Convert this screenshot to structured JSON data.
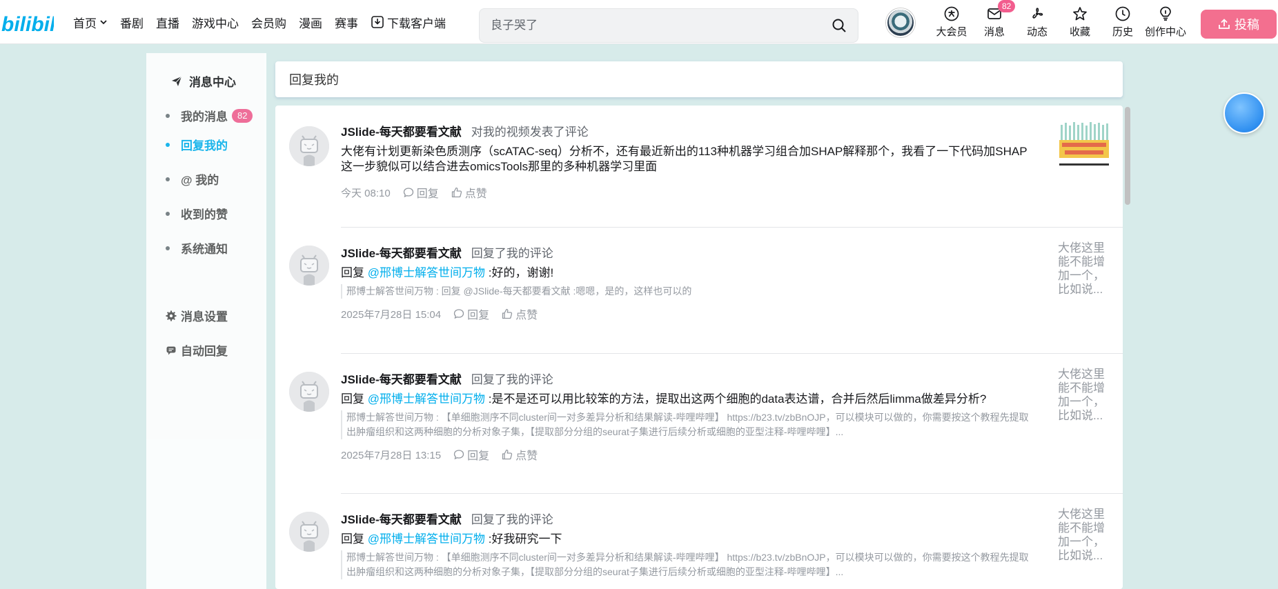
{
  "nav": {
    "items": [
      "首页",
      "番剧",
      "直播",
      "游戏中心",
      "会员购",
      "漫画",
      "赛事",
      "下载客户端"
    ],
    "search_placeholder": "良子哭了",
    "right": [
      {
        "label": "大会员",
        "icon": "vip-icon"
      },
      {
        "label": "消息",
        "icon": "message-icon",
        "badge": "82"
      },
      {
        "label": "动态",
        "icon": "dynamic-icon"
      },
      {
        "label": "收藏",
        "icon": "star-icon"
      },
      {
        "label": "历史",
        "icon": "history-icon"
      },
      {
        "label": "创作中心",
        "icon": "bulb-icon"
      }
    ],
    "upload_label": "投稿"
  },
  "sidebar": {
    "title": "消息中心",
    "items": [
      {
        "label": "我的消息",
        "badge": "82"
      },
      {
        "label": "回复我的"
      },
      {
        "label": "@ 我的"
      },
      {
        "label": "收到的赞"
      },
      {
        "label": "系统通知"
      }
    ],
    "settings": "消息设置",
    "auto_reply": "自动回复"
  },
  "header": {
    "title": "回复我的"
  },
  "replies": [
    {
      "user": "JSlide-每天都要看文献",
      "action": "对我的视频发表了评论",
      "content": "大佬有计划更新染色质测序（scATAC-seq）分析不，还有最近新出的113种机器学习组合加SHAP解释那个，我看了一下代码加SHAP这一步貌似可以结合进去omicsTools那里的多种机器学习里面",
      "time": "今天 08:10",
      "reply_label": "回复",
      "like_label": "点赞"
    },
    {
      "user": "JSlide-每天都要看文献",
      "action": "回复了我的评论",
      "prefix": "回复 ",
      "mention": "@邢博士解答世间万物",
      "content": " :好的，谢谢!",
      "quote": "邢博士解答世间万物 : 回复 @JSlide-每天都要看文献 :嗯嗯，是的，这样也可以的",
      "time": "2025年7月28日 15:04",
      "side_text": "大佬这里能不能增加一个，比如说...",
      "reply_label": "回复",
      "like_label": "点赞"
    },
    {
      "user": "JSlide-每天都要看文献",
      "action": "回复了我的评论",
      "prefix": "回复 ",
      "mention": "@邢博士解答世间万物",
      "content": " :是不是还可以用比较笨的方法，提取出这两个细胞的data表达谱，合并后然后limma做差异分析?",
      "quote": "邢博士解答世间万物 : 【单细胞测序不同cluster间一对多差异分析和结果解读-哔哩哔哩】 https://b23.tv/zbBnOJP，可以模块可以做的，你需要按这个教程先提取出肿瘤组织和这两种细胞的分析对象子集，【提取部分分组的seurat子集进行后续分析或细胞的亚型注释-哔哩哔哩】...",
      "time": "2025年7月28日 13:15",
      "side_text": "大佬这里能不能增加一个，比如说...",
      "reply_label": "回复",
      "like_label": "点赞"
    },
    {
      "user": "JSlide-每天都要看文献",
      "action": "回复了我的评论",
      "prefix": "回复 ",
      "mention": "@邢博士解答世间万物",
      "content": " :好我研究一下",
      "quote": "邢博士解答世间万物 : 【单细胞测序不同cluster间一对多差异分析和结果解读-哔哩哔哩】 https://b23.tv/zbBnOJP，可以模块可以做的，你需要按这个教程先提取出肿瘤组织和这两种细胞的分析对象子集，【提取部分分组的seurat子集进行后续分析或细胞的亚型注释-哔哩哔哩】...",
      "side_text": "大佬这里能不能增加一个，比如说..."
    }
  ],
  "colors": {
    "accent": "#00aeec",
    "pink": "#f25d8e",
    "upload": "#f36f8f",
    "bg": "#d7ebea"
  }
}
